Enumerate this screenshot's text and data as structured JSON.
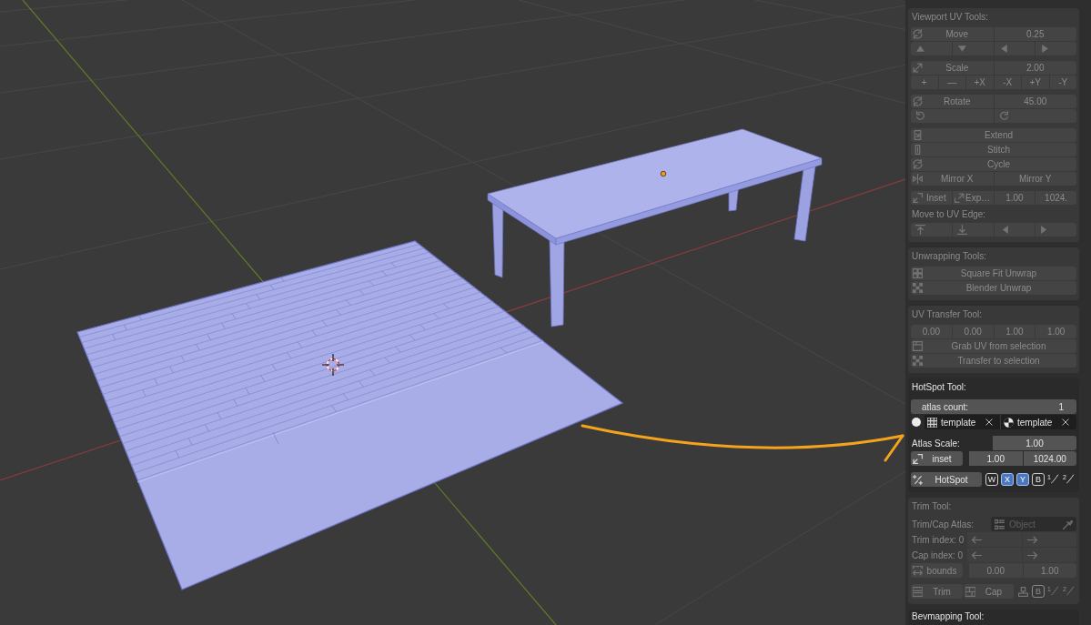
{
  "sidebar": {
    "viewport_uv_tools": {
      "title": "Viewport UV Tools:",
      "disabled": true,
      "move": {
        "label": "Move",
        "value": "0.25"
      },
      "scale": {
        "label": "Scale",
        "value": "2.00",
        "steps": [
          "+",
          "—",
          "+X",
          "-X",
          "+Y",
          "-Y"
        ]
      },
      "rotate": {
        "label": "Rotate",
        "value": "45.00"
      },
      "actions": [
        "Extend",
        "Stitch",
        "Cycle"
      ],
      "mirror": [
        "Mirror X",
        "Mirror Y"
      ],
      "inset": {
        "label": "Inset",
        "expand": "Exp…",
        "values": [
          "1.00",
          "1024."
        ]
      },
      "edge_label": "Move to UV Edge:"
    },
    "unwrapping_tools": {
      "title": "Unwrapping Tools:",
      "disabled": true,
      "buttons": [
        "Square Fit Unwrap",
        "Blender Unwrap"
      ]
    },
    "uv_transfer_tool": {
      "title": "UV Transfer Tool:",
      "disabled": true,
      "values": [
        "0.00",
        "0.00",
        "1.00",
        "1.00"
      ],
      "buttons": [
        "Grab UV from selection",
        "Transfer to selection"
      ]
    },
    "hotspot_tool": {
      "title": "HotSpot Tool:",
      "disabled": false,
      "atlas_count": {
        "label": "atlas count:",
        "value": "1"
      },
      "templates": [
        "template",
        "template"
      ],
      "atlas_scale": {
        "label": "Atlas Scale:",
        "value": "1.00"
      },
      "inset": {
        "label": "inset",
        "values": [
          "1.00",
          "1024.00"
        ]
      },
      "hotspot": {
        "label": "HotSpot",
        "toggles": [
          {
            "label": "W",
            "on": false
          },
          {
            "label": "X",
            "on": true
          },
          {
            "label": "Y",
            "on": true
          },
          {
            "label": "B",
            "on": false
          }
        ],
        "fractions": [
          "1",
          "2"
        ]
      }
    },
    "trim_tool": {
      "title": "Trim Tool:",
      "disabled": true,
      "atlas": {
        "label": "Trim/Cap Atlas:",
        "placeholder": "Object"
      },
      "indices": [
        "Trim index: 0",
        "Cap index: 0"
      ],
      "bounds": {
        "label": "bounds",
        "values": [
          "0.00",
          "1.00"
        ]
      },
      "buttons": [
        "Trim",
        "Cap"
      ],
      "toggles": [
        {
          "label": "B",
          "on": false
        }
      ],
      "fractions": [
        "1",
        "2"
      ]
    },
    "bevmapping_tool": {
      "title": "Bevmapping Tool:",
      "disabled": false
    }
  }
}
